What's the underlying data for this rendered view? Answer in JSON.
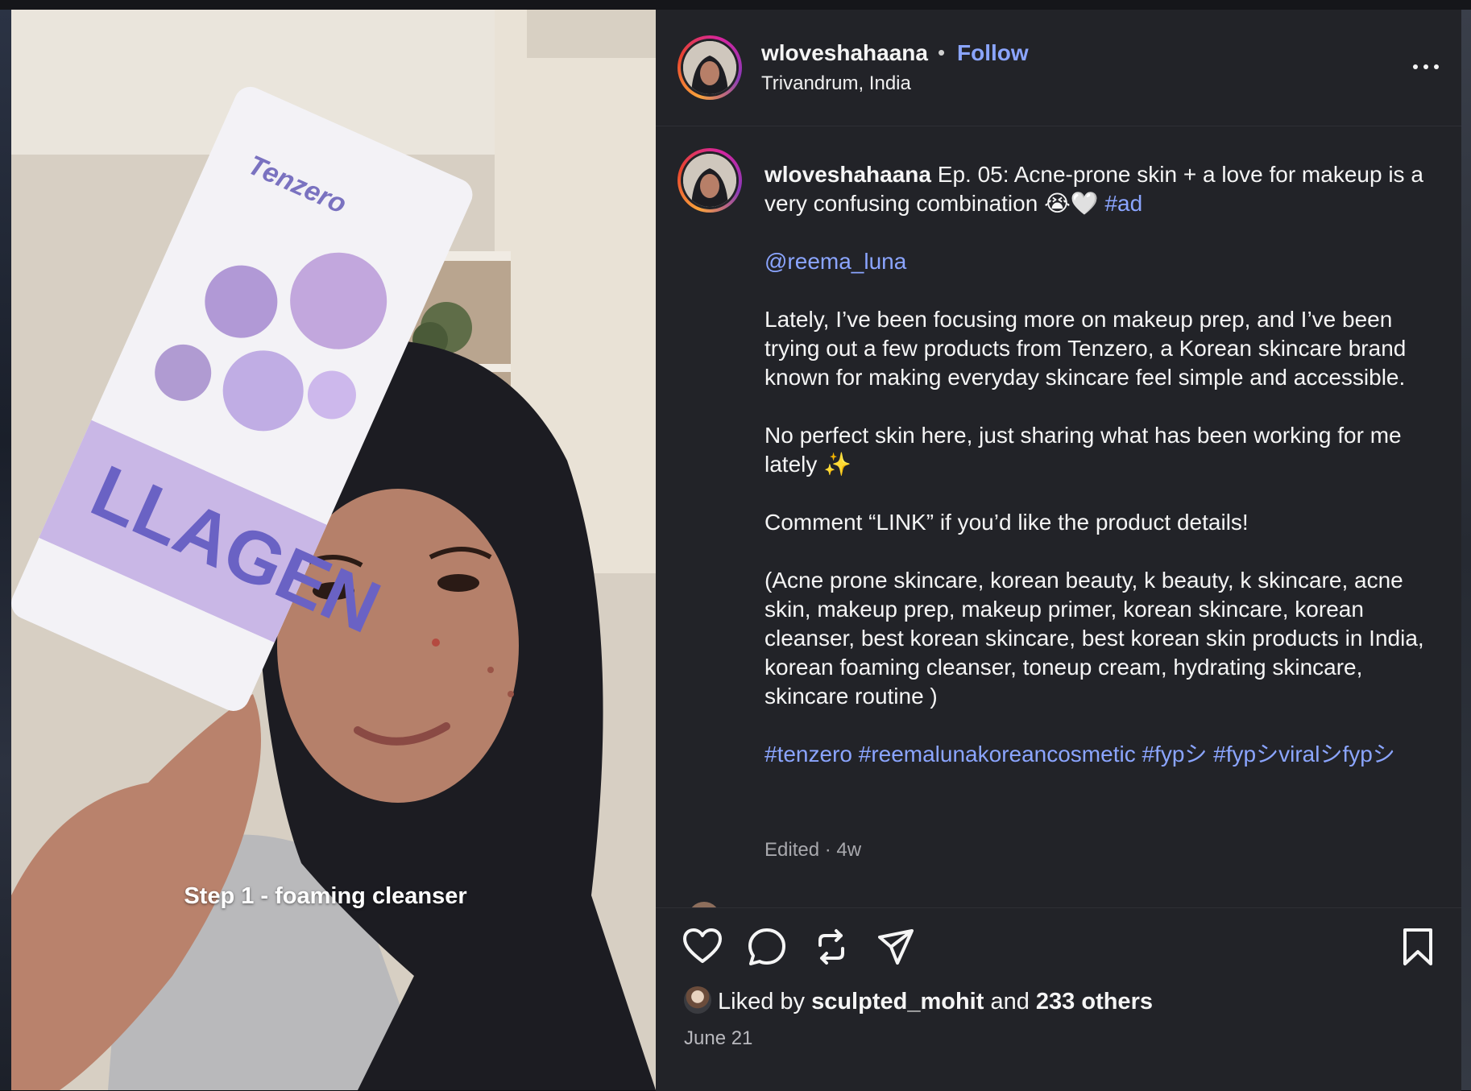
{
  "post": {
    "username": "wloveshahaana",
    "follow_label": "Follow",
    "separator": "•",
    "location": "Trivandrum, India",
    "media_caption": "Step 1 - foaming cleanser",
    "product_text": "LLAGEN",
    "product_brand": "Tenzero"
  },
  "caption": {
    "username": "wloveshahaana",
    "line1": "Ep. 05: Acne-prone skin + a love for makeup is a very confusing combination 😭🤍",
    "ad_tag": "#ad",
    "mention": "@reema_luna",
    "para1": "Lately, I’ve been focusing more on makeup prep, and I’ve been trying out a few products from Tenzero, a Korean skincare brand known for making everyday skincare feel simple and accessible.",
    "para2": "No perfect skin here, just sharing what has been working for me lately ✨",
    "para3": "Comment “LINK” if you’d like the product details!",
    "para4": "(Acne prone skincare, korean beauty, k beauty, k skincare, acne skin, makeup prep, makeup primer, korean skincare, korean cleanser, best korean skincare, best korean skin products in India, korean foaming cleanser, toneup cream, hydrating skincare, skincare routine )",
    "hashtags": "#tenzero #reemalunakoreancosmetic #fypシ #fypシviralシfypシ",
    "meta": "Edited · 4w"
  },
  "actions": {
    "icons": [
      "heart-icon",
      "comment-icon",
      "repost-icon",
      "share-icon",
      "bookmark-icon"
    ]
  },
  "likes": {
    "prefix": "Liked by",
    "user": "sculpted_mohit",
    "middle": "and",
    "others": "233 others"
  },
  "date": "June 21",
  "colors": {
    "panel_bg": "#222328",
    "link": "#8ba5ff",
    "text": "#f5f5f5",
    "muted": "#a8a8ad"
  }
}
